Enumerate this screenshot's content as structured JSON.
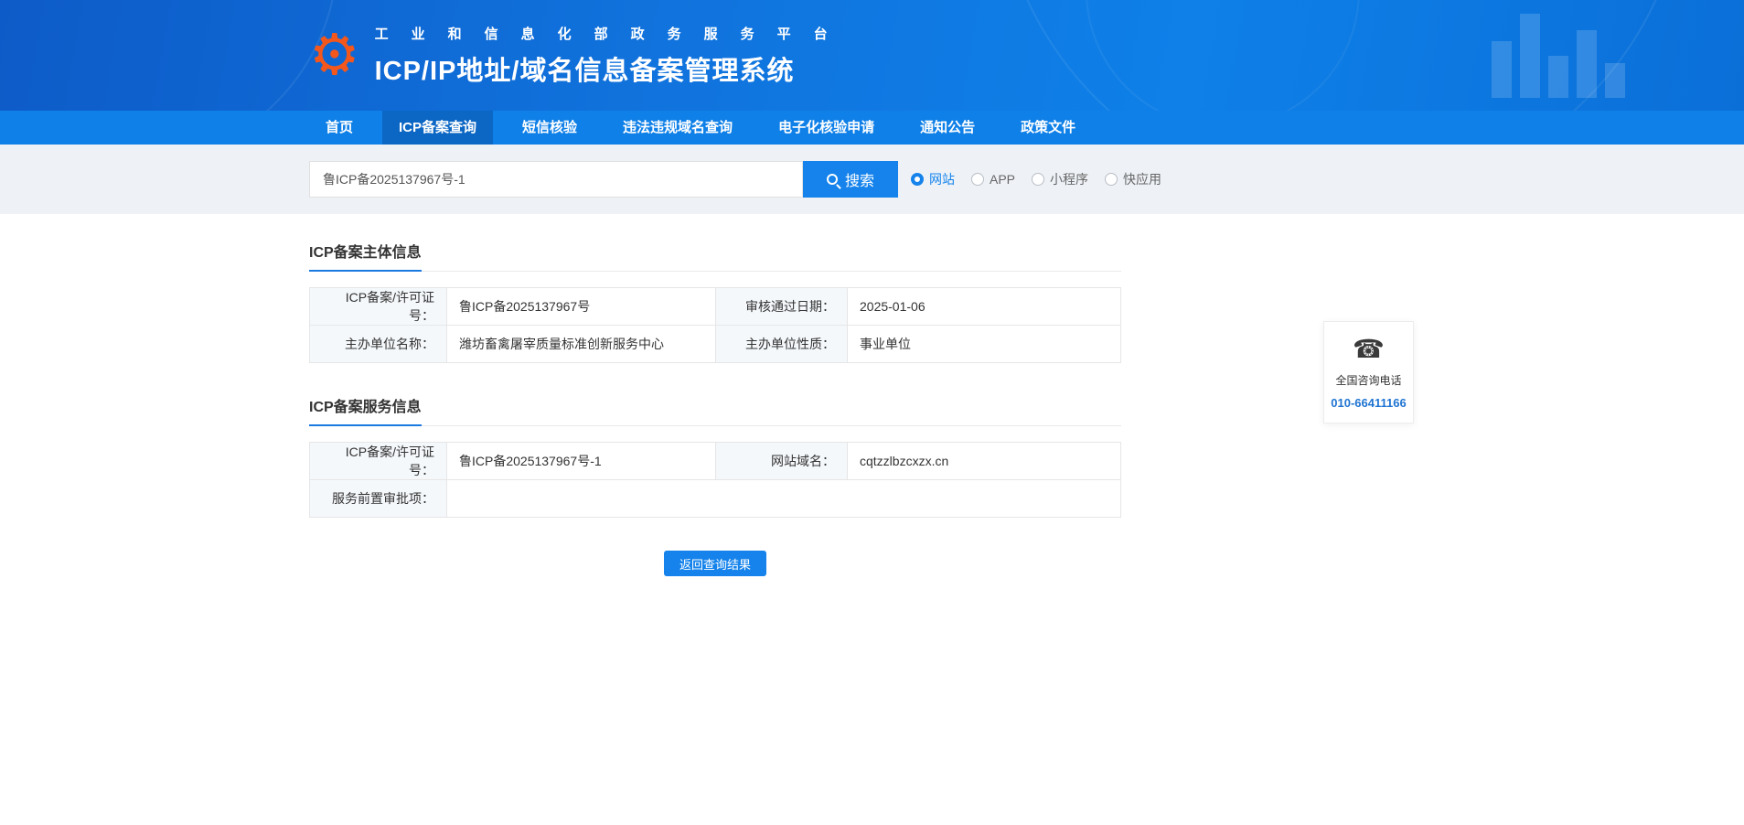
{
  "header": {
    "subtitle": "工业和信息化部政务服务平台",
    "title": "ICP/IP地址/域名信息备案管理系统"
  },
  "nav": {
    "items": [
      {
        "label": "首页",
        "active": false
      },
      {
        "label": "ICP备案查询",
        "active": true
      },
      {
        "label": "短信核验",
        "active": false
      },
      {
        "label": "违法违规域名查询",
        "active": false
      },
      {
        "label": "电子化核验申请",
        "active": false
      },
      {
        "label": "通知公告",
        "active": false
      },
      {
        "label": "政策文件",
        "active": false
      }
    ]
  },
  "search": {
    "value": "鲁ICP备2025137967号-1",
    "button_label": "搜索",
    "options": [
      {
        "label": "网站",
        "selected": true
      },
      {
        "label": "APP",
        "selected": false
      },
      {
        "label": "小程序",
        "selected": false
      },
      {
        "label": "快应用",
        "selected": false
      }
    ]
  },
  "subject": {
    "title": "ICP备案主体信息",
    "rows": [
      {
        "l1": "ICP备案/许可证号：",
        "v1": "鲁ICP备2025137967号",
        "l2": "审核通过日期：",
        "v2": "2025-01-06"
      },
      {
        "l1": "主办单位名称：",
        "v1": "潍坊畜禽屠宰质量标准创新服务中心",
        "l2": "主办单位性质：",
        "v2": "事业单位"
      }
    ]
  },
  "service": {
    "title": "ICP备案服务信息",
    "rows": [
      {
        "l1": "ICP备案/许可证号：",
        "v1": "鲁ICP备2025137967号-1",
        "l2": "网站域名：",
        "v2": "cqtzzlbzcxzx.cn"
      },
      {
        "l1": "服务前置审批项：",
        "v1": ""
      }
    ]
  },
  "back_button_label": "返回查询结果",
  "contact": {
    "label": "全国咨询电话",
    "phone": "010-66411166"
  },
  "icons": {
    "logo": "gear-icon",
    "search": "magnifier-icon",
    "contact": "telephone-icon"
  },
  "colors": {
    "header_blue": "#0f6fd8",
    "nav_blue": "#0f80e8",
    "nav_active_blue": "#0b66c4",
    "accent_blue": "#1583eb",
    "logo_orange": "#f4571c",
    "phone_blue": "#1f74d2",
    "search_bg": "#eef2f7"
  }
}
